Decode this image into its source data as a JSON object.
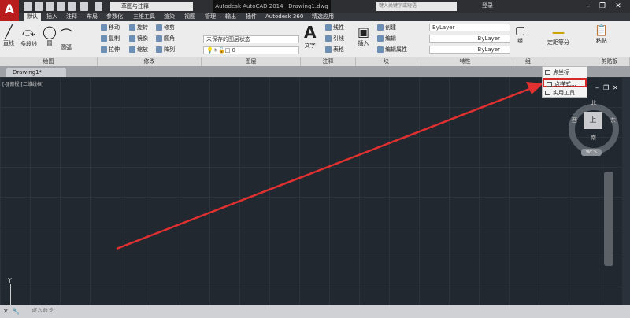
{
  "app": {
    "logo": "A",
    "workspace": "草图与注释",
    "title": "Autodesk AutoCAD 2014",
    "file": "Drawing1.dwg",
    "search_placeholder": "键入关键字或短语",
    "login": "登录"
  },
  "tabs": [
    "默认",
    "插入",
    "注释",
    "布局",
    "参数化",
    "三维工具",
    "渲染",
    "视图",
    "管理",
    "输出",
    "插件",
    "Autodesk 360",
    "精选应用"
  ],
  "ribbon": {
    "draw": {
      "label": "绘图",
      "items": [
        "直线",
        "多段线",
        "圆",
        "圆弧"
      ]
    },
    "modify": {
      "label": "修改",
      "items": [
        "移动",
        "旋转",
        "修剪",
        "复制",
        "镜像",
        "圆角",
        "拉伸",
        "缩放",
        "阵列"
      ]
    },
    "layers": {
      "label": "图层",
      "state": "未保存的图层状态",
      "current": "0"
    },
    "annotation": {
      "label": "注释",
      "items": [
        "文字",
        "线性",
        "引线",
        "表格"
      ]
    },
    "block": {
      "label": "块",
      "items": [
        "插入",
        "创建",
        "编辑",
        "编辑属性"
      ]
    },
    "properties": {
      "label": "特性",
      "color": "ByLayer",
      "linetype": "ByLayer",
      "lineweight": "ByLayer"
    },
    "groups": {
      "label": "组",
      "items": [
        "组"
      ]
    },
    "utilities": {
      "items": [
        "定距等分"
      ]
    },
    "clipboard": {
      "label": "剪贴板",
      "items": [
        "粘贴"
      ]
    }
  },
  "drawing_tab": "Drawing1*",
  "viewport_label": "[-][俯视][二维线框]",
  "dropdown": {
    "items": [
      "点坐标",
      "点样式...",
      "实用工具"
    ],
    "highlighted": "点样式..."
  },
  "viewcube": {
    "face": "上",
    "north": "北",
    "south": "南",
    "east": "东",
    "west": "西",
    "wcs": "WCS"
  },
  "ucs": {
    "y": "Y"
  },
  "command": {
    "placeholder": "键入命令"
  },
  "colors": {
    "accent": "#d42a2a",
    "canvas": "#212830"
  }
}
